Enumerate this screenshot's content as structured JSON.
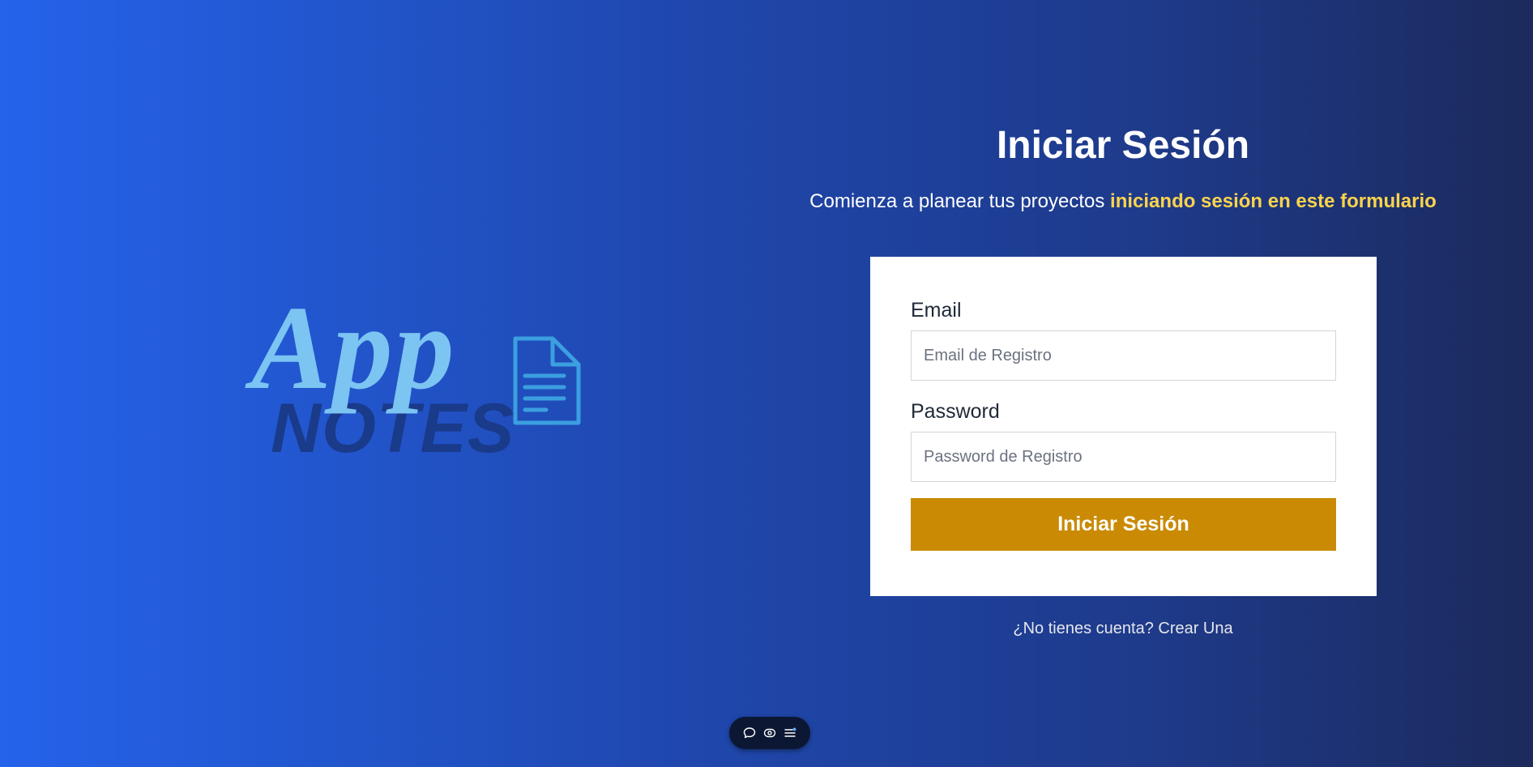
{
  "logo": {
    "app_text": "App",
    "notes_text": "NOTES",
    "icon": "document-icon"
  },
  "login": {
    "title": "Iniciar Sesión",
    "subtitle_plain": "Comienza a planear tus proyectos ",
    "subtitle_highlight": "iniciando sesión en este formulario",
    "email_label": "Email",
    "email_placeholder": "Email de Registro",
    "email_value": "",
    "password_label": "Password",
    "password_placeholder": "Password de Registro",
    "password_value": "",
    "submit_label": "Iniciar Sesión",
    "signup_link": "¿No tienes cuenta? Crear Una"
  },
  "toolbar": {
    "items": [
      "chat-bubble-icon",
      "eye-icon",
      "menu-icon"
    ]
  },
  "colors": {
    "accent": "#ca8a04",
    "highlight": "#fcd34d",
    "background_start": "#2563eb",
    "background_end": "#1c2a5c",
    "logo_light": "#7cc4f2",
    "logo_dark": "#1a3a8a"
  }
}
